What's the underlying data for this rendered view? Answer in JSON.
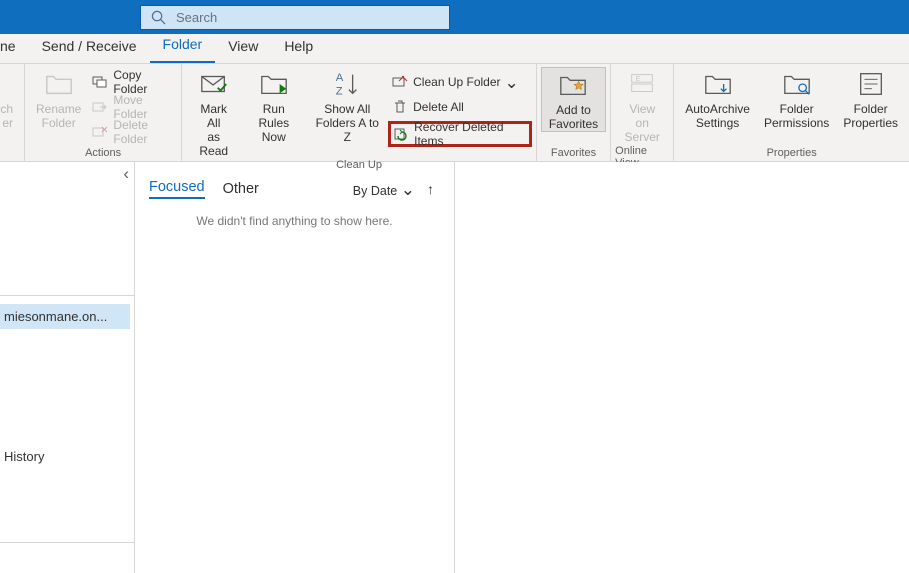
{
  "search": {
    "placeholder": "Search"
  },
  "tabs": {
    "partial": "ne",
    "send_receive": "Send / Receive",
    "folder": "Folder",
    "view": "View",
    "help": "Help"
  },
  "ribbon": {
    "partial_btn": {
      "line1": "rch",
      "line2": "er"
    },
    "rename": {
      "line1": "Rename",
      "line2": "Folder"
    },
    "copy_folder": "Copy Folder",
    "move_folder": "Move Folder",
    "delete_folder": "Delete Folder",
    "actions_label": "Actions",
    "mark_all": {
      "line1": "Mark All",
      "line2": "as Read"
    },
    "run_rules": {
      "line1": "Run Rules",
      "line2": "Now"
    },
    "show_all": {
      "line1": "Show All",
      "line2": "Folders A to Z"
    },
    "clean_up_folder": "Clean Up Folder",
    "delete_all": "Delete All",
    "recover": "Recover Deleted Items",
    "cleanup_label": "Clean Up",
    "add_fav": {
      "line1": "Add to",
      "line2": "Favorites"
    },
    "fav_label": "Favorites",
    "view_server": {
      "line1": "View on",
      "line2": "Server"
    },
    "online_label": "Online View",
    "autoarchive": {
      "line1": "AutoArchive",
      "line2": "Settings"
    },
    "permissions": {
      "line1": "Folder",
      "line2": "Permissions"
    },
    "properties": {
      "line1": "Folder",
      "line2": "Properties"
    },
    "props_label": "Properties"
  },
  "nav": {
    "account": "miesonmane.on...",
    "history": "History"
  },
  "list": {
    "focused": "Focused",
    "other": "Other",
    "sort": "By Date",
    "empty": "We didn't find anything to show here."
  }
}
